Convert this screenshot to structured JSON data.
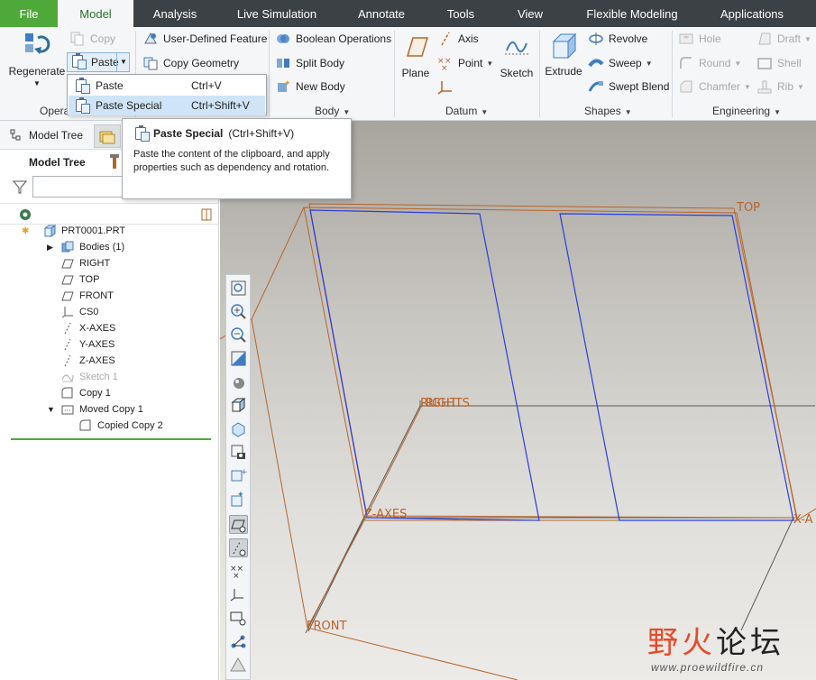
{
  "menu": {
    "tabs": [
      "File",
      "Model",
      "Analysis",
      "Live Simulation",
      "Annotate",
      "Tools",
      "View",
      "Flexible Modeling",
      "Applications"
    ]
  },
  "ribbon": {
    "regenerate": "Regenerate",
    "copy": "Copy",
    "paste": "Paste",
    "operations_group": "Opera",
    "user_defined_feature": "User-Defined Feature",
    "copy_geometry": "Copy Geometry",
    "boolean_operations": "Boolean Operations",
    "split_body": "Split Body",
    "new_body": "New Body",
    "body_group": "Body",
    "plane": "Plane",
    "axis": "Axis",
    "point": "Point",
    "sketch": "Sketch",
    "datum_group": "Datum",
    "extrude": "Extrude",
    "revolve": "Revolve",
    "sweep": "Sweep",
    "swept_blend": "Swept Blend",
    "shapes_group": "Shapes",
    "hole": "Hole",
    "draft": "Draft",
    "round": "Round",
    "shell": "Shell",
    "chamfer": "Chamfer",
    "rib": "Rib",
    "engineering_group": "Engineering"
  },
  "dropdown": {
    "items": [
      {
        "label": "Paste",
        "shortcut": "Ctrl+V"
      },
      {
        "label": "Paste Special",
        "shortcut": "Ctrl+Shift+V"
      }
    ]
  },
  "tooltip": {
    "title": "Paste Special",
    "shortcut": "(Ctrl+Shift+V)",
    "body": "Paste the content of the clipboard, and apply properties such as dependency and rotation."
  },
  "leftpanel": {
    "tab_label": "Model Tree",
    "header": "Model Tree",
    "tree": [
      {
        "label": "PRT0001.PRT"
      },
      {
        "label": "Bodies (1)"
      },
      {
        "label": "RIGHT"
      },
      {
        "label": "TOP"
      },
      {
        "label": "FRONT"
      },
      {
        "label": "CS0"
      },
      {
        "label": "X-AXES"
      },
      {
        "label": "Y-AXES"
      },
      {
        "label": "Z-AXES"
      },
      {
        "label": "Sketch 1"
      },
      {
        "label": "Copy 1"
      },
      {
        "label": "Moved Copy 1"
      },
      {
        "label": "Copied Copy 2"
      }
    ]
  },
  "viewport": {
    "labels": {
      "top": "TOP",
      "right": "RIGHT",
      "rights": "RIGHTS",
      "z_axes": "Z-AXES",
      "x_axes_partial": "X-A",
      "front": "FRONT"
    }
  },
  "watermark": {
    "logo_first": "野火",
    "logo_rest": "论坛",
    "url": "www.proewildfire.cn"
  },
  "colors": {
    "menubar": "#3c4145",
    "file_tab": "#4fa83a",
    "datum_orange": "#b8642a",
    "sketch_blue": "#2a3ddb",
    "edge_gray": "#5a5a5a"
  }
}
